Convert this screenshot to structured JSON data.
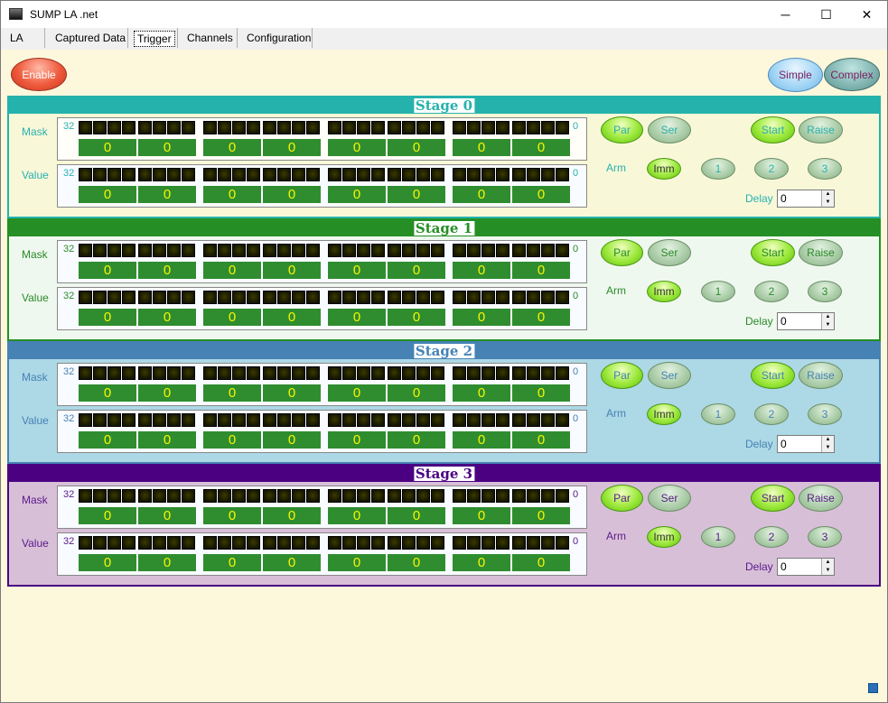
{
  "window": {
    "title": "SUMP LA .net",
    "minimize_glyph": "─",
    "maximize_glyph": "☐",
    "close_glyph": "✕"
  },
  "menu": {
    "tabs": [
      "LA",
      "Captured Data",
      "Trigger",
      "Channels",
      "Configuration"
    ],
    "active": "Trigger"
  },
  "toolbar": {
    "enable_label": "Enable",
    "simple_label": "Simple",
    "complex_label": "Complex"
  },
  "stages": [
    {
      "title": "Stage 0",
      "header_color": "#26b2ac",
      "body_color": "#f8f8d8",
      "label_color": "#2ab0b0",
      "title_color": "#26b2ac",
      "mask_label": "Mask",
      "value_label": "Value",
      "mask_hex": [
        "0",
        "0",
        "0",
        "0",
        "0",
        "0",
        "0",
        "0"
      ],
      "value_hex": [
        "0",
        "0",
        "0",
        "0",
        "0",
        "0",
        "0",
        "0"
      ],
      "bit_high": "32",
      "bit_low": "0",
      "mode": {
        "par": "Par",
        "ser": "Ser",
        "active": "Par"
      },
      "action": {
        "start": "Start",
        "raise": "Raise",
        "active": "Start"
      },
      "arm": {
        "label": "Arm",
        "options": [
          "Imm",
          "1",
          "2",
          "3"
        ],
        "active": "Imm"
      },
      "delay": {
        "label": "Delay",
        "value": "0"
      }
    },
    {
      "title": "Stage 1",
      "header_color": "#258f25",
      "body_color": "#eff8ef",
      "label_color": "#2a8a2a",
      "title_color": "#258f25",
      "mask_label": "Mask",
      "value_label": "Value",
      "mask_hex": [
        "0",
        "0",
        "0",
        "0",
        "0",
        "0",
        "0",
        "0"
      ],
      "value_hex": [
        "0",
        "0",
        "0",
        "0",
        "0",
        "0",
        "0",
        "0"
      ],
      "bit_high": "32",
      "bit_low": "0",
      "mode": {
        "par": "Par",
        "ser": "Ser",
        "active": "Par"
      },
      "action": {
        "start": "Start",
        "raise": "Raise",
        "active": "Start"
      },
      "arm": {
        "label": "Arm",
        "options": [
          "Imm",
          "1",
          "2",
          "3"
        ],
        "active": "Imm"
      },
      "delay": {
        "label": "Delay",
        "value": "0"
      }
    },
    {
      "title": "Stage 2",
      "header_color": "#4682b4",
      "body_color": "#add8e6",
      "label_color": "#4682b4",
      "title_color": "#4682b4",
      "mask_label": "Mask",
      "value_label": "Value",
      "mask_hex": [
        "0",
        "0",
        "0",
        "0",
        "0",
        "0",
        "0",
        "0"
      ],
      "value_hex": [
        "0",
        "0",
        "0",
        "0",
        "0",
        "0",
        "0",
        "0"
      ],
      "bit_high": "32",
      "bit_low": "0",
      "mode": {
        "par": "Par",
        "ser": "Ser",
        "active": "Par"
      },
      "action": {
        "start": "Start",
        "raise": "Raise",
        "active": "Start"
      },
      "arm": {
        "label": "Arm",
        "options": [
          "Imm",
          "1",
          "2",
          "3"
        ],
        "active": "Imm"
      },
      "delay": {
        "label": "Delay",
        "value": "0"
      }
    },
    {
      "title": "Stage 3",
      "header_color": "#4b0082",
      "body_color": "#d8bfd8",
      "label_color": "#5a1a8a",
      "title_color": "#4b0082",
      "mask_label": "Mask",
      "value_label": "Value",
      "mask_hex": [
        "0",
        "0",
        "0",
        "0",
        "0",
        "0",
        "0",
        "0"
      ],
      "value_hex": [
        "0",
        "0",
        "0",
        "0",
        "0",
        "0",
        "0",
        "0"
      ],
      "bit_high": "32",
      "bit_low": "0",
      "mode": {
        "par": "Par",
        "ser": "Ser",
        "active": "Par"
      },
      "action": {
        "start": "Start",
        "raise": "Raise",
        "active": "Start"
      },
      "arm": {
        "label": "Arm",
        "options": [
          "Imm",
          "1",
          "2",
          "3"
        ],
        "active": "Imm"
      },
      "delay": {
        "label": "Delay",
        "value": "0"
      }
    }
  ]
}
